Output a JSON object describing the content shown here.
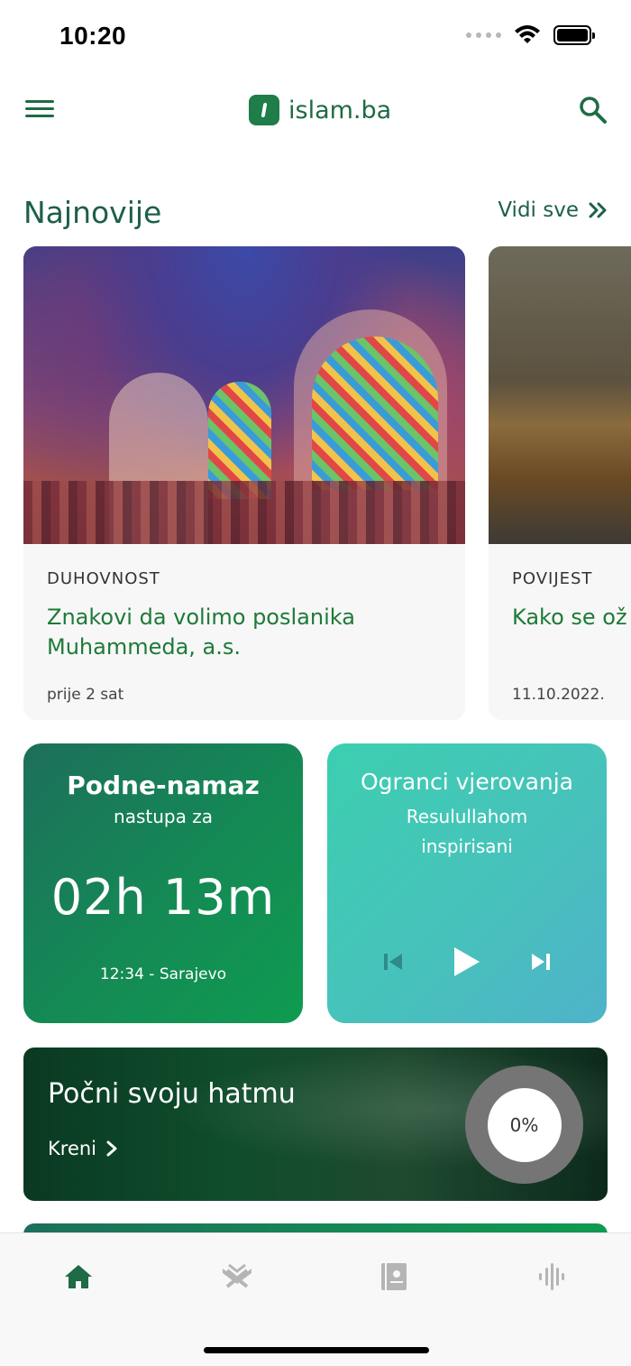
{
  "status_bar": {
    "time": "10:20"
  },
  "header": {
    "brand": "islam.ba"
  },
  "latest": {
    "title": "Najnovije",
    "see_all": "Vidi sve",
    "articles": [
      {
        "category": "DUHOVNOST",
        "title": "Znakovi da volimo poslanika Muhammeda, a.s.",
        "time": "prije 2 sat"
      },
      {
        "category": "POVIJEST",
        "title": "Kako se ož",
        "time": "11.10.2022."
      }
    ]
  },
  "prayer_widget": {
    "title": "Podne-namaz",
    "subtitle": "nastupa za",
    "countdown": "02h 13m",
    "location": "12:34 - Sarajevo"
  },
  "audio_widget": {
    "title": "Ogranci vjerovanja",
    "subtitle": "Resulullahom inspirisani"
  },
  "hatma": {
    "title": "Počni svoju hatmu",
    "action": "Kreni",
    "progress_label": "0%",
    "progress": 0
  },
  "tabs": [
    {
      "icon": "home-icon",
      "active": true
    },
    {
      "icon": "quran-icon",
      "active": false
    },
    {
      "icon": "book-icon",
      "active": false
    },
    {
      "icon": "audio-wave-icon",
      "active": false
    }
  ],
  "colors": {
    "brand_green": "#1e7d48",
    "title_green": "#1e5f4a",
    "inactive_icon": "#b5b5b5"
  }
}
